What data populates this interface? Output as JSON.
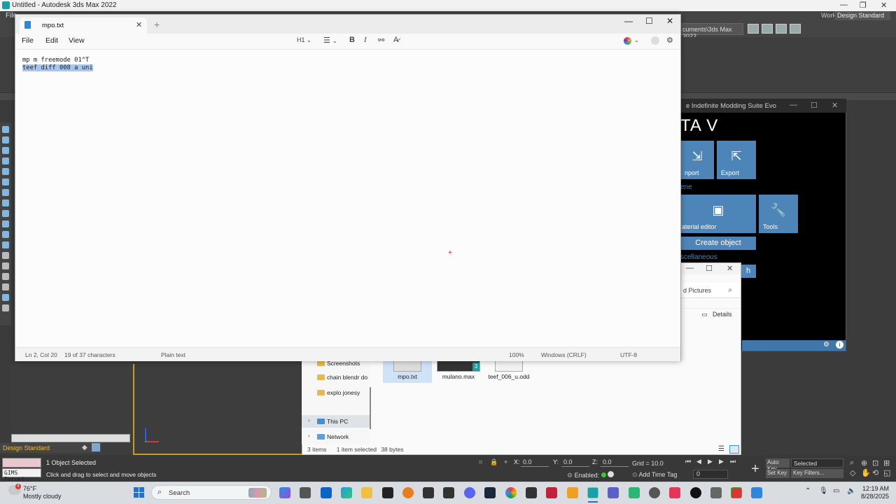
{
  "max": {
    "title": "Untitled - Autodesk 3ds Max 2022",
    "menu_file": "File",
    "workspaces_label": "Workspaces:",
    "workspaces_value": "Design Standard",
    "path_text": "cuments\\3ds Max 2022",
    "workspace_bottom": "Design Standard",
    "object_selected": "1 Object Selected",
    "click_drag": "Click and drag to select and move objects",
    "gims_field": "GIMS Force(",
    "x_label": "X:",
    "x_value": "0.0",
    "y_label": "Y:",
    "y_value": "0.0",
    "z_label": "Z:",
    "z_value": "0.0",
    "grid_text": "Grid = 10.0",
    "enabled_text": "Enabled:",
    "add_time_tag": "Add Time Tag",
    "auto_key": "Auto Key",
    "set_key": "Set Key",
    "selected_dropdown": "Selected",
    "key_filters": "Key Filters...",
    "frame_value": "0"
  },
  "notepad": {
    "tab_title": "mpo.txt",
    "menus": [
      "File",
      "Edit",
      "View"
    ],
    "heading_tool": "H1",
    "lines": [
      "mp m freemode 01^T",
      "teef diff 008 a uni"
    ],
    "status": {
      "position": "Ln 2, Col 20",
      "selection": "19 of 37 characters",
      "format": "Plain text",
      "zoom": "100%",
      "line_endings": "Windows (CRLF)",
      "encoding": "UTF-8"
    }
  },
  "modding_suite": {
    "title": "e Indefinite Modding Suite Evo",
    "heading": "TA V",
    "import_label": "nport",
    "export_label": "Export",
    "scene_section": "ene",
    "material_editor_label": "aterial editor",
    "tools_label": "Tools",
    "create_object_label": "Create object",
    "misc_section": "scellaneous",
    "search_partial": "h"
  },
  "explorer": {
    "search_placeholder": "d Pictures",
    "details_label": "Details",
    "nav": [
      "Screenshots",
      "chain blendr do",
      "explo jonesy",
      "This PC",
      "Network"
    ],
    "files": [
      "mpo.txt",
      "mulano.max",
      "teef_006_u.odd"
    ],
    "mulano_badge": "3",
    "status_items": "3 items",
    "status_selected": "1 item selected",
    "status_size": "38 bytes"
  },
  "taskbar": {
    "weather_temp": "76°F",
    "weather_desc": "Mostly cloudy",
    "weather_badge": "4",
    "search_placeholder": "Search",
    "time": "12:19 AM",
    "date": "8/28/2025"
  }
}
